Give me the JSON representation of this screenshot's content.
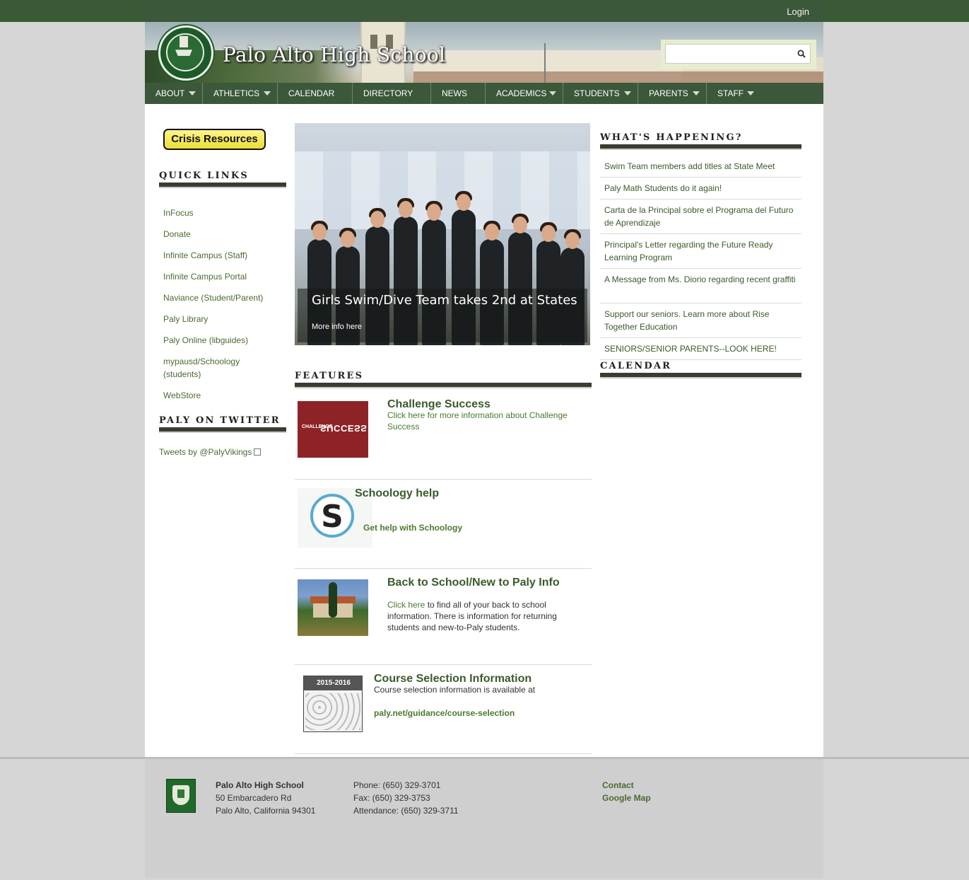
{
  "topbar": {
    "login": "Login"
  },
  "header": {
    "site_title": "Palo Alto High School",
    "search_placeholder": ""
  },
  "nav": [
    {
      "label": "ABOUT",
      "has_dropdown": true
    },
    {
      "label": "ATHLETICS",
      "has_dropdown": true
    },
    {
      "label": "CALENDAR",
      "has_dropdown": false
    },
    {
      "label": "DIRECTORY",
      "has_dropdown": false
    },
    {
      "label": "NEWS",
      "has_dropdown": false
    },
    {
      "label": "ACADEMICS",
      "has_dropdown": true
    },
    {
      "label": "STUDENTS",
      "has_dropdown": true
    },
    {
      "label": "PARENTS",
      "has_dropdown": true
    },
    {
      "label": "STAFF",
      "has_dropdown": true
    }
  ],
  "sidebar": {
    "crisis_button": "Crisis Resources",
    "quick_links_title": "QUICK LINKS",
    "quick_links": [
      "InFocus",
      "Donate",
      "Infinite Campus (Staff)",
      "Infinite Campus Portal",
      "Naviance (Student/Parent)",
      "Paly Library",
      "Paly Online (libguides)",
      "mypausd/Schoology (students)",
      "WebStore"
    ],
    "twitter_title": "PALY ON TWITTER",
    "twitter_link": "Tweets by @PalyVikings"
  },
  "slideshow": {
    "caption_title": "Girls Swim/Dive Team takes 2nd at States",
    "caption_link": "More info here"
  },
  "features": {
    "title": "FEATURES",
    "items": [
      {
        "title": "Challenge Success",
        "text": "Click here for more information about Challenge Success",
        "image_text_1": "CHALLENGE",
        "image_text_2": "SUCCESS"
      },
      {
        "title": "Schoology help",
        "link": "Get help with Schoology",
        "image_text": "S"
      },
      {
        "title": "Back to School/New to Paly Info",
        "link": "Click here",
        "text": "to find all of your back to school information. There is information for returning students and new-to-Paly students."
      },
      {
        "title": "Course Selection Information",
        "text": "Course selection information is available at",
        "link": "paly.net/guidance/course-selection",
        "image_text": "2015-2016"
      }
    ]
  },
  "whats_happening": {
    "title": "WHAT'S HAPPENING?",
    "items": [
      "Swim Team members add titles at State Meet",
      "Paly Math Students do it again!",
      "Carta de la Principal sobre el Programa del Futuro de Aprendizaje",
      "Principal's Letter regarding the Future Ready Learning Program",
      "A Message from Ms. Diorio regarding recent graffiti",
      "Support our seniors. Learn more about Rise Together Education",
      "SENIORS/SENIOR PARENTS--LOOK HERE!"
    ]
  },
  "calendar_title": "CALENDAR",
  "footer": {
    "school_name": "Palo Alto High School",
    "address_1": "50 Embarcadero Rd",
    "address_2": "Palo Alto, California 94301",
    "phone": "Phone: (650) 329-3701",
    "fax": "Fax: (650) 329-3753",
    "attendance": "Attendance: (650) 329-3711",
    "contact": "Contact",
    "map": "Google Map"
  },
  "colors": {
    "nav_green": "#3b583a",
    "link_green": "#4a6a33",
    "rule_dark": "#3b3b33",
    "crisis_yellow": "#f2e65a"
  }
}
